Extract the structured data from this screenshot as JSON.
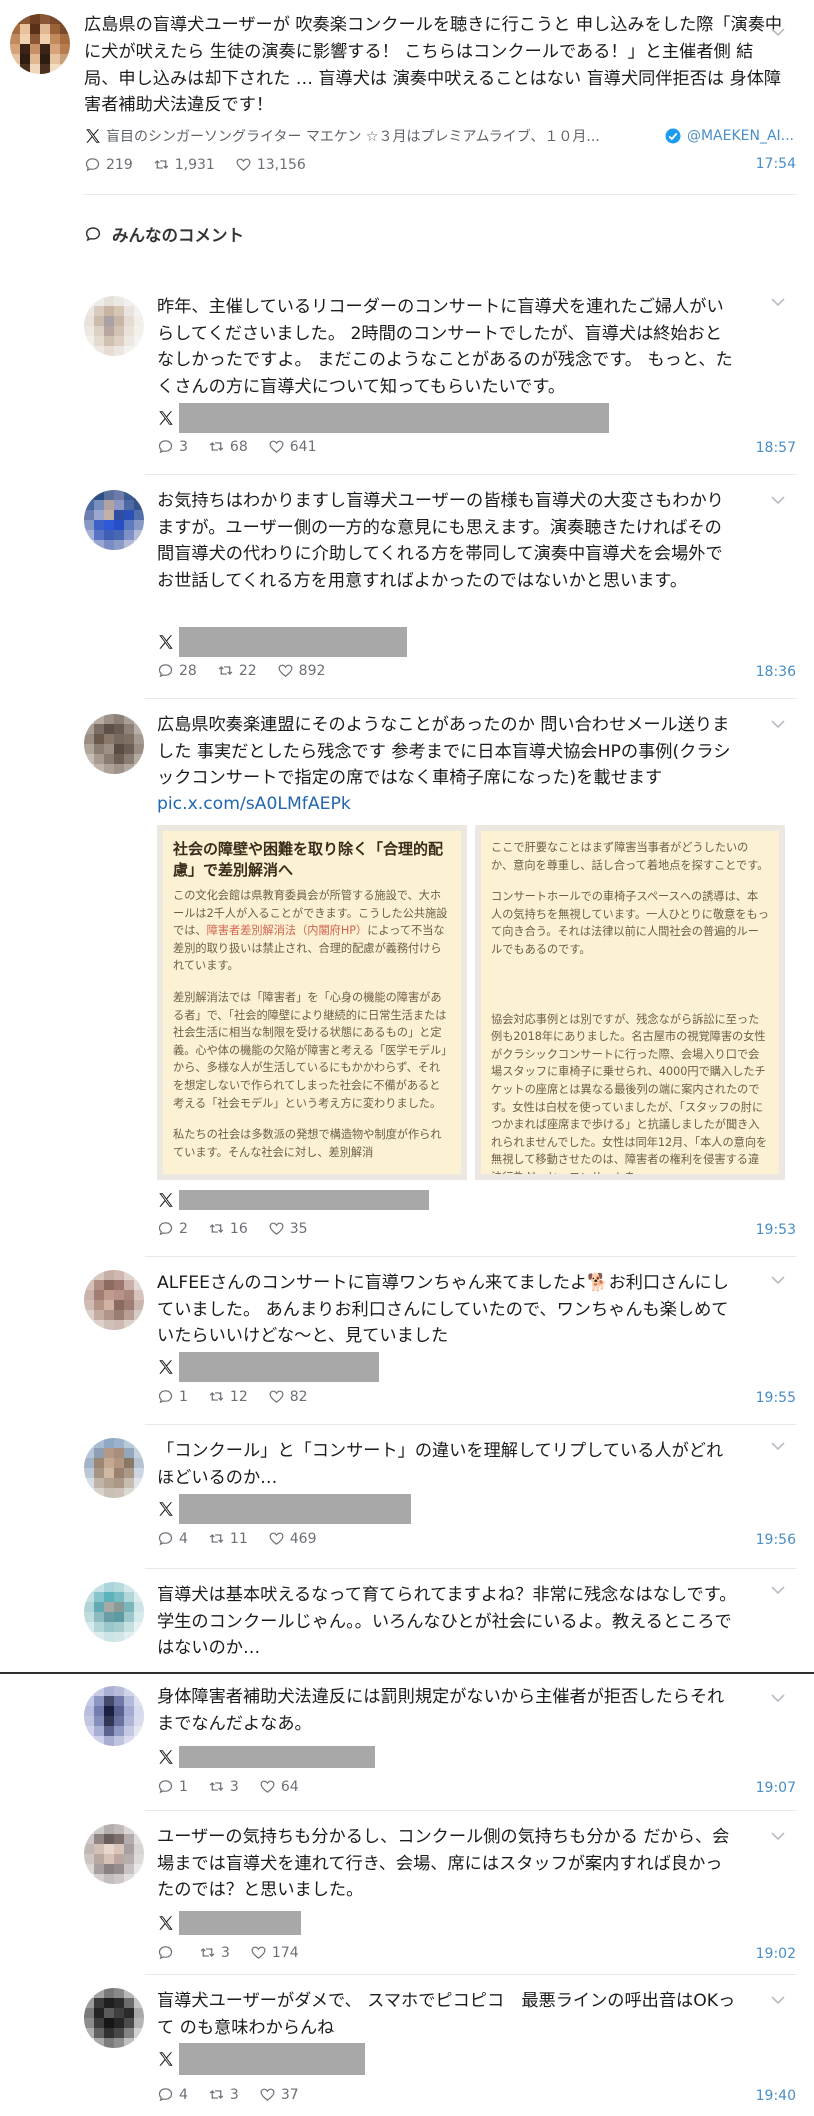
{
  "top_post": {
    "text": "広島県の盲導犬ユーザーが 吹奏楽コンクールを聴きに行こうと 申し込みをした際「演奏中に犬が吠えたら 生徒の演奏に影響する！ こちらはコンクールである！」と主催者側 結局、申し込みは却下された … 盲導犬は 演奏中吠えることはない 盲導犬同伴拒否は 身体障害者補助犬法違反です！",
    "author": "盲目のシンガーソングライター マエケン ☆３月はプレミアムライブ、１０月...",
    "handle": "@MAEKEN_AI...",
    "replies": "219",
    "retweets": "1,931",
    "likes": "13,156",
    "time": "17:54"
  },
  "comments_heading": "みんなのコメント",
  "comments": [
    {
      "text": "昨年、主催しているリコーダーのコンサートに盲導犬を連れたご婦人がいらしてくださいました。 2時間のコンサートでしたが、盲導犬は終始おとなしかったですよ。 まだこのようなことがあるのが残念です。 もっと、たくさんの方に盲導犬について知ってもらいたいです。",
      "replies": "3",
      "retweets": "68",
      "likes": "641",
      "time": "18:57"
    },
    {
      "text": "お気持ちはわかりますし盲導犬ユーザーの皆様も盲導犬の大変さもわかりますが。ユーザー側の一方的な意見にも思えます。演奏聴きたければその間盲導犬の代わりに介助してくれる方を帯同して演奏中盲導犬を会場外でお世話してくれる方を用意すればよかったのではないかと思います。",
      "replies": "28",
      "retweets": "22",
      "likes": "892",
      "time": "18:36"
    },
    {
      "text": "広島県吹奏楽連盟にそのようなことがあったのか 問い合わせメール送りました 事実だとしたら残念です 参考までに日本盲導犬協会HPの事例(クラシックコンサートで指定の席ではなく車椅子席になった)を載せます",
      "link": "pic.x.com/sA0LMfAEPk",
      "replies": "2",
      "retweets": "16",
      "likes": "35",
      "time": "19:53"
    },
    {
      "text": "ALFEEさんのコンサートに盲導ワンちゃん来てましたよ🐕お利口さんにしていました。 あんまりお利口さんにしていたので、ワンちゃんも楽しめていたらいいけどな〜と、見ていました",
      "replies": "1",
      "retweets": "12",
      "likes": "82",
      "time": "19:55"
    },
    {
      "text": "「コンクール」と「コンサート」の違いを理解してリプしている人がどれほどいるのか…",
      "replies": "4",
      "retweets": "11",
      "likes": "469",
      "time": "19:56"
    },
    {
      "text": "盲導犬は基本吠えるなって育てられてますよね？非常に残念なはなしです。 学生のコンクールじゃん。。いろんなひとが社会にいるよ。教えるところではないのか…"
    },
    {
      "text": "身体障害者補助犬法違反には罰則規定がないから主催者が拒否したらそれまでなんだよなあ。",
      "replies": "1",
      "retweets": "3",
      "likes": "64",
      "time": "19:07"
    },
    {
      "text": "ユーザーの気持ちも分かるし、コンクール側の気持ちも分かる だから、会場までは盲導犬を連れて行き、会場、席にはスタッフが案内すれば良かったのでは？と思いました。",
      "replies": "",
      "retweets": "3",
      "likes": "174",
      "time": "19:02"
    },
    {
      "text": "盲導犬ユーザーがダメで、 スマホでピコピコ　最悪ラインの呼出音はOKって のも意味わからんね",
      "replies": "4",
      "retweets": "3",
      "likes": "37",
      "time": "19:40"
    }
  ],
  "embedded_image": {
    "left_heading": "社会の障壁や困難を取り除く「合理的配慮」で差別解消へ",
    "left_p1_a": "この文化会館は県教育委員会が所管する施設で、大ホールは2千人が入ることができます。こうした公共施設では、",
    "left_p1_red": "障害者差別解消法（内閣府HP）",
    "left_p1_b": "によって不当な差別的取り扱いは禁止され、合理的配慮が義務付けられています。",
    "left_p2": "差別解消法では「障害者」を「心身の機能の障害がある者」で、「社会的障壁により継続的に日常生活または社会生活に相当な制限を受ける状態にあるもの」と定義。心や体の機能の欠陥が障害と考える「医学モデル」から、多様な人が生活しているにもかかわらず、それを想定しないで作られてしまった社会に不備があると考える「社会モデル」という考え方に変わりました。",
    "left_p3": "私たちの社会は多数派の発想で構造物や制度が作られています。そんな社会に対し、差別解消",
    "right_p1": "ここで肝要なことはまず障害当事者がどうしたいのか、意向を尊重し、話し合って着地点を探すことです。",
    "right_p2": "コンサートホールでの車椅子スペースへの誘導は、本人の気持ちを無視しています。一人ひとりに敬意をもって向き合う。それは法律以前に人間社会の普遍的ルールでもあるのです。",
    "right_p3": "協会対応事例とは別ですが、残念ながら訴訟に至った例も2018年にありました。名古屋市の視覚障害の女性がクラシックコンサートに行った際、会場入り口で会場スタッフに車椅子に乗せられ、4000円で購入したチケットの座席とは異なる最後列の端に案内されたのです。女性は白杖を使っていましたが、「スタッフの肘につかまれば座席まで歩ける」と抗議しましたが聞き入れられませんでした。女性は同年12月、「本人の意向を無視して移動させたのは、障害者の権利を侵害する違法行為だ」と、コンサートを"
  },
  "colors": {
    "time": "#4a8ec6",
    "link": "#2367b0",
    "verified": "#1d9bf0",
    "redaction": "#a8a8a8"
  }
}
